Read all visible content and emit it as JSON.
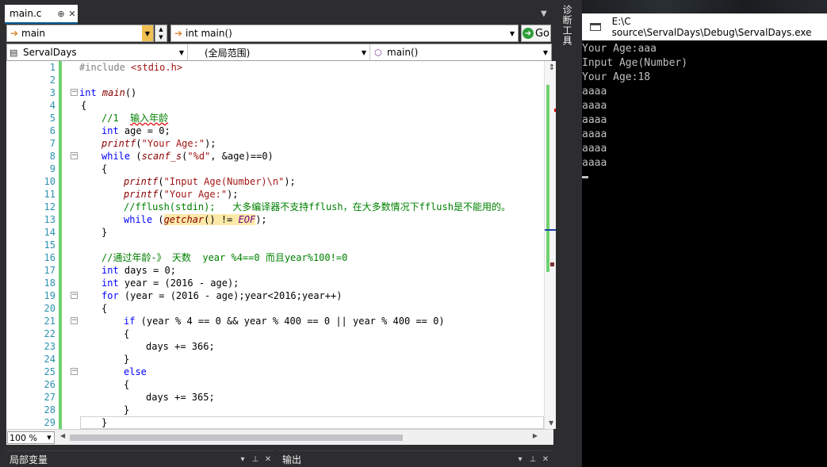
{
  "ide": {
    "tab": {
      "label": "main.c",
      "pin": "⊕",
      "close": "✕"
    },
    "nav": {
      "scope_combo": "main",
      "func_combo": "int main()",
      "go_label": "Go",
      "project": "ServalDays",
      "global_scope": "(全局范围)",
      "member": "main()"
    },
    "zoom": "100 %",
    "side_tab": "诊断工具",
    "panels": {
      "locals": "局部变量",
      "output": "输出"
    },
    "code_lines": [
      {
        "n": "1"
      },
      {
        "n": "2"
      },
      {
        "n": "3"
      },
      {
        "n": "4"
      },
      {
        "n": "5"
      },
      {
        "n": "6"
      },
      {
        "n": "7"
      },
      {
        "n": "8"
      },
      {
        "n": "9"
      },
      {
        "n": "10"
      },
      {
        "n": "11"
      },
      {
        "n": "12"
      },
      {
        "n": "13"
      },
      {
        "n": "14"
      },
      {
        "n": "15"
      },
      {
        "n": "16"
      },
      {
        "n": "17"
      },
      {
        "n": "18"
      },
      {
        "n": "19"
      },
      {
        "n": "20"
      },
      {
        "n": "21"
      },
      {
        "n": "22"
      },
      {
        "n": "23"
      },
      {
        "n": "24"
      },
      {
        "n": "25"
      },
      {
        "n": "26"
      },
      {
        "n": "27"
      },
      {
        "n": "28"
      },
      {
        "n": "29"
      }
    ],
    "code": {
      "l1_a": "#include ",
      "l1_b": "<stdio.h>",
      "l3_a": "int",
      "l3_b": " ",
      "l3_c": "main",
      "l3_d": "()",
      "l4": "{",
      "l5_a": "//1  ",
      "l5_b": "输入年龄",
      "l6_a": "int",
      "l6_b": " age = 0;",
      "l7_a": "printf",
      "l7_b": "(",
      "l7_c": "\"Your Age:\"",
      "l7_d": ");",
      "l8_a": "while",
      "l8_b": " (",
      "l8_c": "scanf_s",
      "l8_d": "(",
      "l8_e": "\"%d\"",
      "l8_f": ", &age)==0)",
      "l9": "{",
      "l10_a": "printf",
      "l10_b": "(",
      "l10_c": "\"Input Age(Number)\\n\"",
      "l10_d": ");",
      "l11_a": "printf",
      "l11_b": "(",
      "l11_c": "\"Your Age:\"",
      "l11_d": ");",
      "l12": "//fflush(stdin);   大多编译器不支持fflush，在大多数情况下fflush是不能用的。",
      "l13_a": "while",
      "l13_b": " (",
      "l13_c": "getchar",
      "l13_d": "() != ",
      "l13_e": "EOF",
      "l13_f": ");",
      "l14": "}",
      "l16": "//通过年龄-》 天数  year %4==0 而且year%100!=0",
      "l17_a": "int",
      "l17_b": " days = 0;",
      "l18_a": "int",
      "l18_b": " year = (2016 - age);",
      "l19_a": "for",
      "l19_b": " (year = (2016 - age);year<2016;year++)",
      "l20": "{",
      "l21_a": "if",
      "l21_b": " (year % 4 == 0 && year % 400 == 0 || year % 400 == 0)",
      "l22": "{",
      "l23": "days += 366;",
      "l24": "}",
      "l25": "else",
      "l26": "{",
      "l27": "days += 365;",
      "l28": "}",
      "l29": "}"
    }
  },
  "console": {
    "title": "E:\\C source\\ServalDays\\Debug\\ServalDays.exe",
    "lines": [
      "Your Age:aaa",
      "Input Age(Number)",
      "Your Age:18",
      "aaaa",
      "aaaa",
      "aaaa",
      "aaaa",
      "aaaa",
      "aaaa"
    ]
  }
}
